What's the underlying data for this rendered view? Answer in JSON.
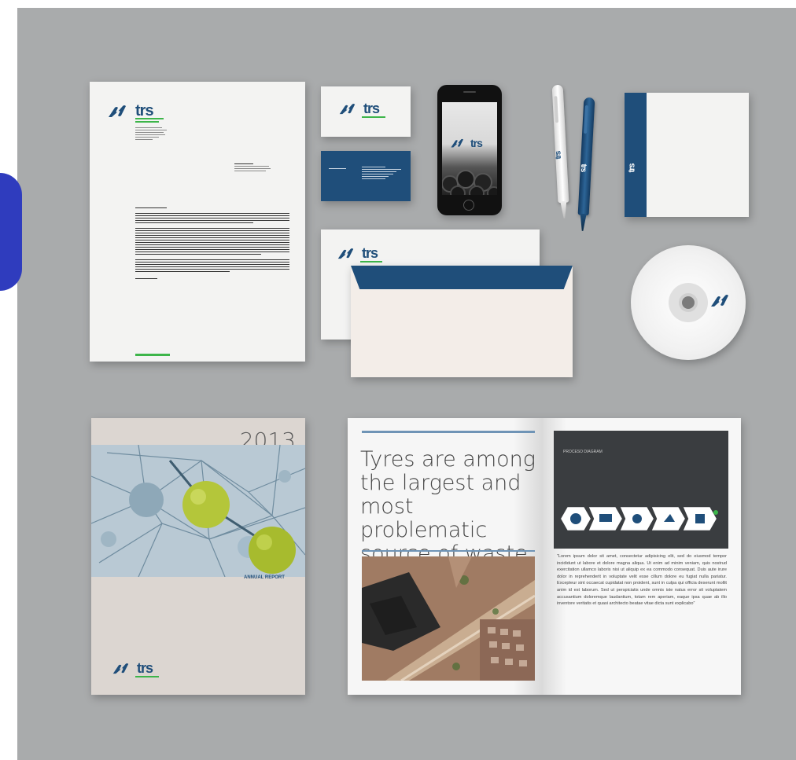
{
  "brand": {
    "logo_text": "trs",
    "colors": {
      "navy": "#1f4e7a",
      "green": "#3db54a",
      "background": "#a9abac"
    }
  },
  "letterhead": {
    "logo_text": "trs",
    "accent_bar_color": "#3db54a"
  },
  "business_card_front": {
    "logo_text": "trs"
  },
  "phone": {
    "logo_text": "trs"
  },
  "envelope": {
    "logo_text": "trs"
  },
  "folder": {
    "logo_text": "trs"
  },
  "pens": [
    {
      "logo_text": "trs",
      "style": "white"
    },
    {
      "logo_text": "trs",
      "style": "navy"
    }
  ],
  "annual_report": {
    "year": "2013",
    "label": "ANNUAL REPORT",
    "logo_text": "trs"
  },
  "brochure": {
    "headline_lines": [
      "Tyres are among",
      "the largest and",
      "most problematic",
      "source of waste"
    ],
    "panel_title": "PROCESO DIAGRAM",
    "body_text": "“Lorem ipsum dolor sit amet, consectetur adipisicing elit, sed do eiusmod tempor incididunt ut labore et dolore magna aliqua. Ut enim ad minim veniam, quis nostrud exercitation ullamco laboris nisi ut aliquip ex ea commodo consequat. Duis aute irure dolor in reprehenderit in voluptate velit esse cillum dolore eu fugiat nulla pariatur. Excepteur sint occaecat cupidatat non proident, sunt in culpa qui officia deserunt mollit anim id est laborum. Sed ut perspiciatis unde omnis iste natus error sit voluptatem accusantium doloremque laudantium, totam rem aperiam, eaque ipsa quae ab illo inventore veritatis et quasi architecto beatae vitae dicta sunt explicabo”"
  }
}
